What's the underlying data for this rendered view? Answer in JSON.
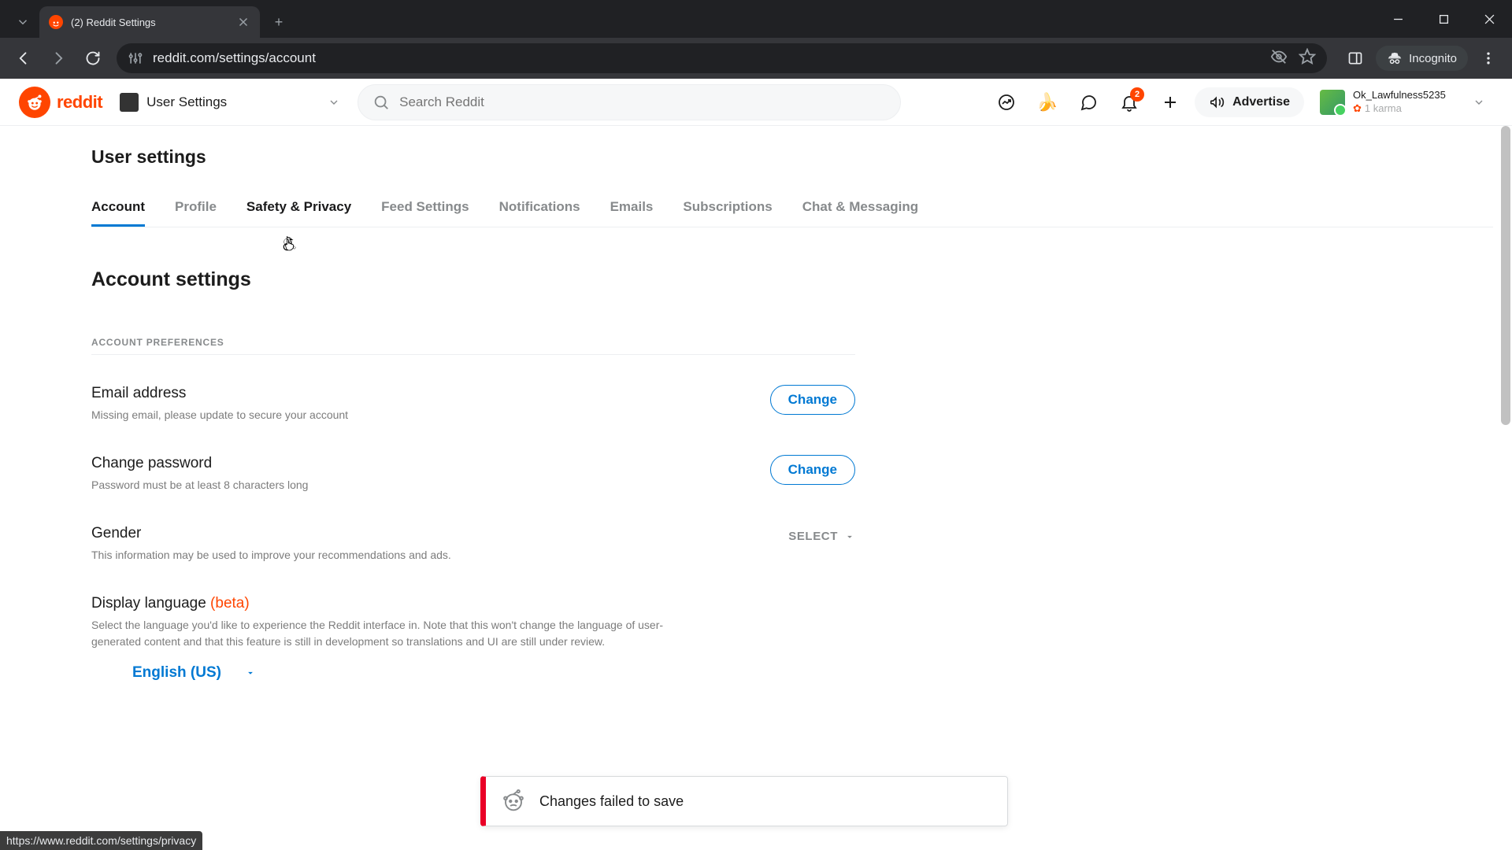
{
  "browser": {
    "tab_title": "(2) Reddit Settings",
    "url": "reddit.com/settings/account",
    "incognito_label": "Incognito",
    "hover_url": "https://www.reddit.com/settings/privacy"
  },
  "header": {
    "logo_text": "reddit",
    "nav_label": "User Settings",
    "search_placeholder": "Search Reddit",
    "notif_count": "2",
    "advertise_label": "Advertise",
    "username": "Ok_Lawfulness5235",
    "karma": "1 karma"
  },
  "page": {
    "title": "User settings",
    "tabs": {
      "account": "Account",
      "profile": "Profile",
      "safety": "Safety & Privacy",
      "feed": "Feed Settings",
      "notifications": "Notifications",
      "emails": "Emails",
      "subscriptions": "Subscriptions",
      "chat": "Chat & Messaging"
    },
    "section_title": "Account settings",
    "subsection": "ACCOUNT PREFERENCES",
    "email": {
      "title": "Email address",
      "desc": "Missing email, please update to secure your account",
      "btn": "Change"
    },
    "password": {
      "title": "Change password",
      "desc": "Password must be at least 8 characters long",
      "btn": "Change"
    },
    "gender": {
      "title": "Gender",
      "desc": "This information may be used to improve your recommendations and ads.",
      "btn": "SELECT"
    },
    "language": {
      "title": "Display language ",
      "beta": "(beta)",
      "desc": "Select the language you'd like to experience the Reddit interface in. Note that this won't change the language of user-generated content and that this feature is still in development so translations and UI are still under review.",
      "value": "English (US)"
    }
  },
  "toast": {
    "message": "Changes failed to save"
  }
}
